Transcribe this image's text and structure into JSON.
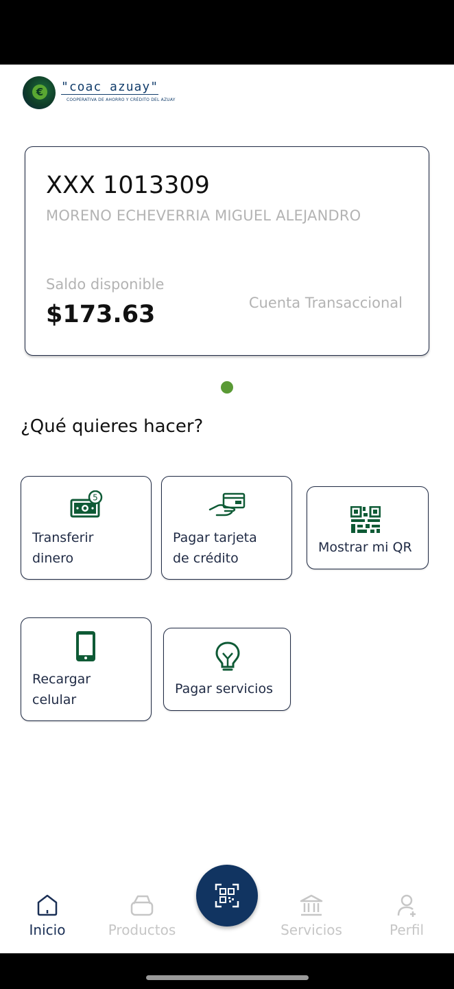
{
  "logo": {
    "name": "\"coac azuay\"",
    "subtitle": "COOPERATIVA DE AHORRO Y CRÉDITO DEL AZUAY"
  },
  "account": {
    "number": "XXX 1013309",
    "holder": "MORENO ECHEVERRIA MIGUEL ALEJANDRO",
    "balance_label": "Saldo disponible",
    "balance": "$173.63",
    "type": "Cuenta Transaccional"
  },
  "section_title": "¿Qué quieres hacer?",
  "actions": {
    "transfer": {
      "line1": "Transferir",
      "line2": "dinero",
      "icon": "money-transfer-icon"
    },
    "credit_card": {
      "line1": "Pagar tarjeta",
      "line2": "de crédito",
      "icon": "credit-card-hand-icon"
    },
    "show_qr": {
      "label": "Mostrar mi QR",
      "icon": "qr-code-icon"
    },
    "recharge": {
      "line1": "Recargar",
      "line2": "celular",
      "icon": "mobile-phone-icon"
    },
    "services": {
      "label": "Pagar servicios",
      "icon": "lightbulb-icon"
    }
  },
  "nav": {
    "inicio": "Inicio",
    "productos": "Productos",
    "servicios": "Servicios",
    "perfil": "Perfil",
    "active": "Inicio"
  },
  "colors": {
    "brand_navy": "#113461",
    "brand_green": "#0e5a35",
    "accent_green": "#5a9a35",
    "muted_text": "#b3b3b3"
  }
}
